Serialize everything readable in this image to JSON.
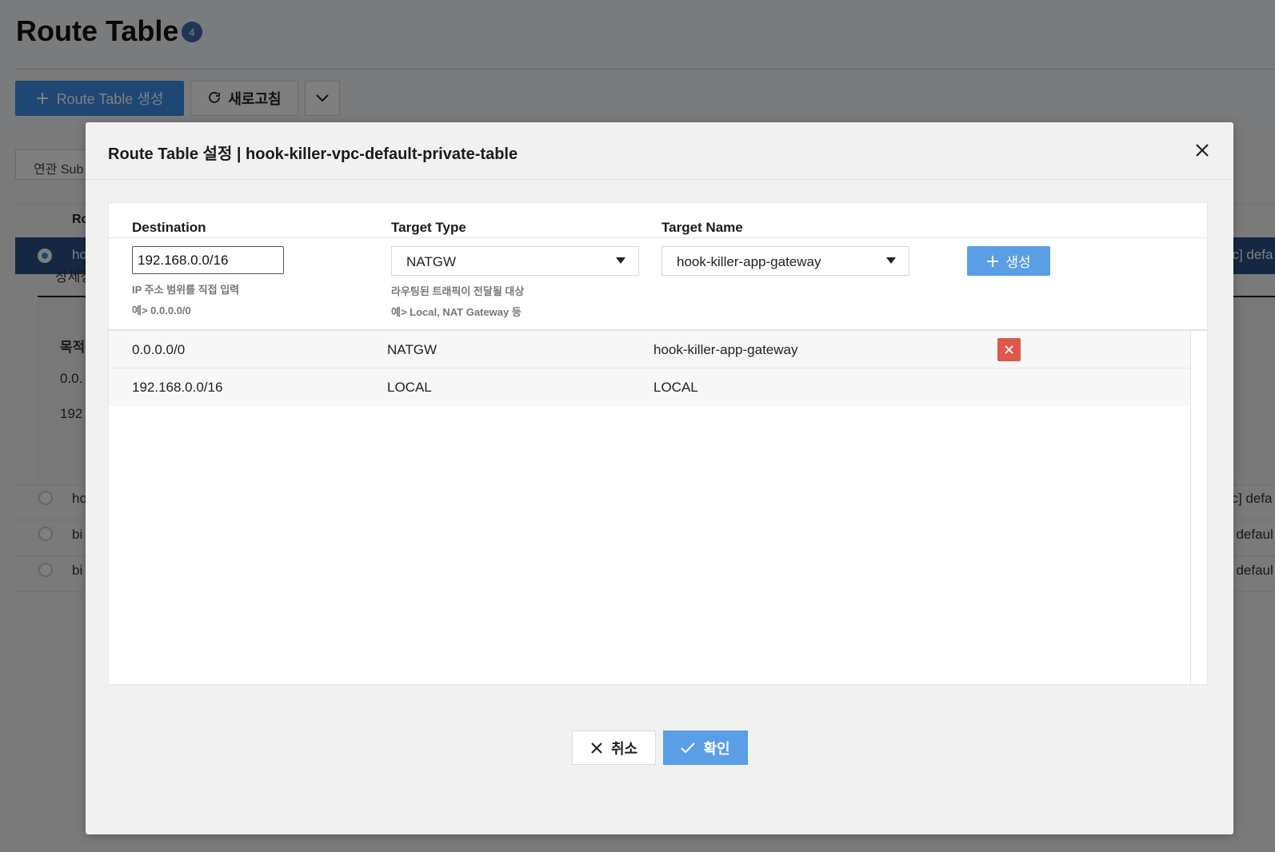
{
  "page": {
    "title": "Route Table",
    "count_badge": "4",
    "create_button": "Route Table 생성",
    "refresh_button": "새로고침",
    "bg_tab_subnet": "연관 Sub",
    "bg_header_col": "Ro",
    "bg_rows": [
      {
        "left": "ho",
        "right": "pc] defa"
      },
      {
        "left": "ho",
        "right": "pc] defa"
      },
      {
        "left": "bi",
        "right": "] defaul"
      },
      {
        "left": "bi",
        "right": "] defaul"
      }
    ],
    "bg_detail_tab": "상세정",
    "bg_detail_head": "목적",
    "bg_detail_rows": [
      "0.0.",
      "192"
    ]
  },
  "modal": {
    "title": "Route Table 설정 | hook-killer-vpc-default-private-table",
    "columns": {
      "destination": "Destination",
      "target_type": "Target Type",
      "target_name": "Target Name"
    },
    "form": {
      "destination_value": "192.168.0.0/16",
      "destination_hint_1": "IP 주소 범위를 직접 입력",
      "destination_hint_2": "예> 0.0.0.0/0",
      "target_type_value": "NATGW",
      "target_type_hint_1": "라우팅된 트래픽이 전달될 대상",
      "target_type_hint_2": "예> Local, NAT Gateway 등",
      "target_name_value": "hook-killer-app-gateway",
      "add_button": "생성"
    },
    "routes": [
      {
        "destination": "0.0.0.0/0",
        "target_type": "NATGW",
        "target_name": "hook-killer-app-gateway",
        "deletable": true
      },
      {
        "destination": "192.168.0.0/16",
        "target_type": "LOCAL",
        "target_name": "LOCAL",
        "deletable": false
      }
    ],
    "cancel_button": "취소",
    "confirm_button": "확인"
  },
  "colors": {
    "primary": "#5a9ee6",
    "danger": "#dd5a4a",
    "selected_row": "#2d4f86"
  }
}
